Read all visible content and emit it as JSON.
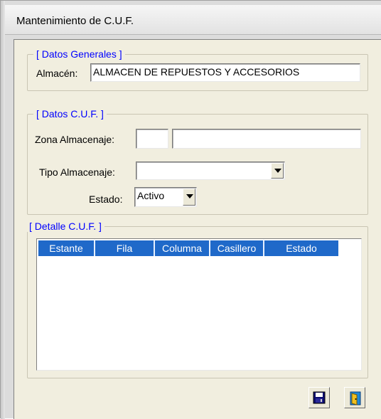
{
  "window": {
    "title": "Mantenimiento de C.U.F."
  },
  "datos_generales": {
    "legend": "[ Datos Generales ]",
    "almacen_label": "Almacén:",
    "almacen_value": "ALMACEN DE REPUESTOS Y ACCESORIOS"
  },
  "datos_cuf": {
    "legend": "[ Datos C.U.F. ]",
    "zona_label": "Zona Almacenaje:",
    "zona_code": "",
    "zona_desc": "",
    "tipo_label": "Tipo Almacenaje:",
    "tipo_value": "",
    "estado_label": "Estado:",
    "estado_value": "Activo"
  },
  "detalle": {
    "legend": "[ Detalle C.U.F. ]",
    "columns": [
      "Estante",
      "Fila",
      "Columna",
      "Casillero",
      "Estado"
    ],
    "rows": []
  },
  "toolbar": {
    "save_icon": "save-icon",
    "exit_icon": "exit-door-icon"
  },
  "colors": {
    "legend_text": "#0000ff",
    "grid_header_bg": "#1f69c9",
    "panel_bg": "#f1eedf"
  }
}
